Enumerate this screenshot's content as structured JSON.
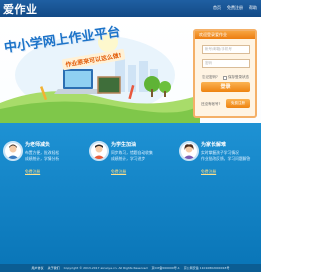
{
  "header": {
    "logo": "爱作业",
    "links": [
      "首页",
      "免费注册",
      "帮助"
    ]
  },
  "hero": {
    "title": "中小学网上作业平台",
    "subtitle": "作业原来可以这么做!"
  },
  "login": {
    "heading": "欢迎登录爱作业",
    "username_placeholder": "帐号/邮箱/手机号",
    "password_placeholder": "密码",
    "remember_label": "忘记密码?",
    "auto_login_label": "保存登录状态",
    "login_button": "登录",
    "register_hint": "还没有帐号?",
    "register_button": "免费注册"
  },
  "features": [
    {
      "title": "为老师减负",
      "line1": "布置方便，批改轻松",
      "line2": "成绩统计，学情分析",
      "link": "免费注册"
    },
    {
      "title": "为学生加油",
      "line1": "同步练习，错题自动收集",
      "line2": "成绩统计，学习进步",
      "link": "免费注册"
    },
    {
      "title": "为家长解难",
      "line1": "实时掌握孩子学习情况",
      "line2": "作业批改反馈，学习问题解答",
      "link": "免费注册"
    }
  ],
  "footer": {
    "items": [
      "用户协议",
      "关于我们",
      "Copyright © 2013-2017 aizuoye.cn. All Rights Reserved",
      "京ICP备000000号-1",
      "京公网安备 11010802000018号"
    ]
  }
}
